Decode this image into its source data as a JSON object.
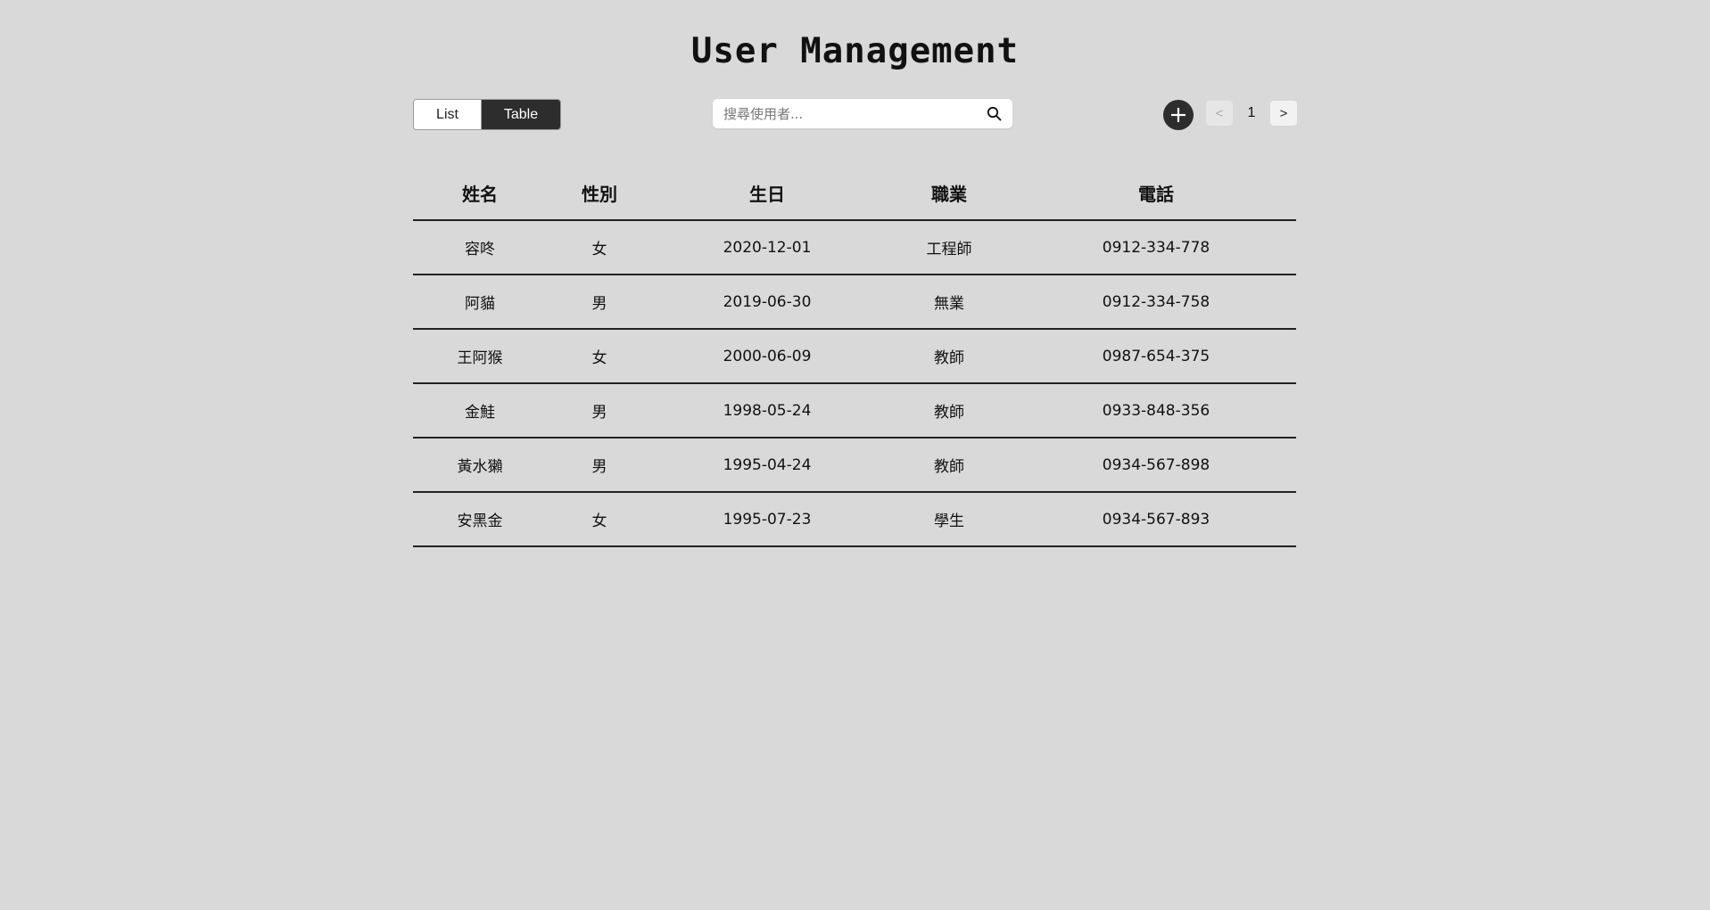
{
  "header": {
    "title": "User Management"
  },
  "toolbar": {
    "view_list_label": "List",
    "view_table_label": "Table",
    "active_view": "Table",
    "search_placeholder": "搜尋使用者...",
    "search_value": "",
    "search_icon": "search-icon",
    "add_icon": "plus-icon",
    "pager": {
      "prev_label": "<",
      "page": "1",
      "next_label": ">"
    }
  },
  "table": {
    "columns": [
      "姓名",
      "性別",
      "生日",
      "職業",
      "電話"
    ],
    "rows": [
      [
        "容咚",
        "女",
        "2020-12-01",
        "工程師",
        "0912-334-778"
      ],
      [
        "阿貓",
        "男",
        "2019-06-30",
        "無業",
        "0912-334-758"
      ],
      [
        "王阿猴",
        "女",
        "2000-06-09",
        "教師",
        "0987-654-375"
      ],
      [
        "金鮭",
        "男",
        "1998-05-24",
        "教師",
        "0933-848-356"
      ],
      [
        "黃水獺",
        "男",
        "1995-04-24",
        "教師",
        "0934-567-898"
      ],
      [
        "安黑金",
        "女",
        "1995-07-23",
        "學生",
        "0934-567-893"
      ]
    ]
  },
  "colors": {
    "background": "#d9d9d9",
    "active_toggle": "#2d2d2d",
    "add_button": "#2d2d2d"
  }
}
